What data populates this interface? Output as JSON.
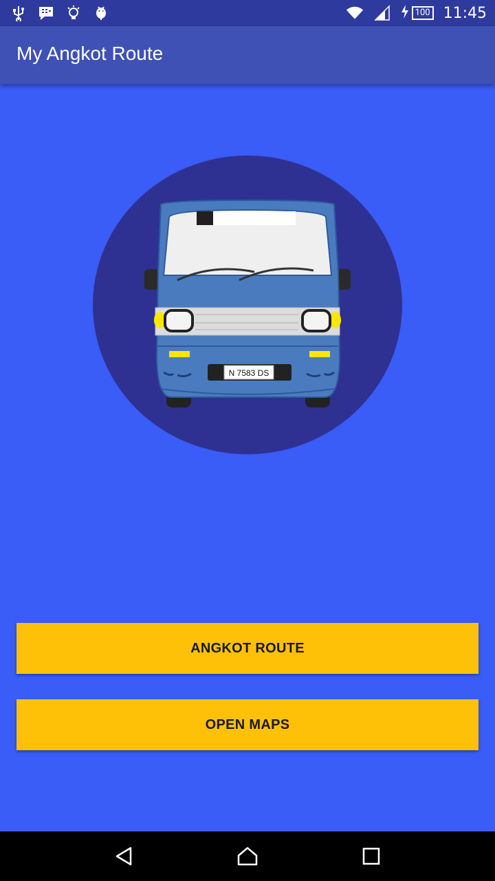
{
  "status_bar": {
    "time": "11:45",
    "battery": "100",
    "left_icons": [
      "usb-icon",
      "bbm-icon",
      "lightbulb-icon",
      "android-debug-icon"
    ],
    "right_icons": [
      "wifi-icon",
      "signal-icon",
      "charging-icon",
      "battery-icon"
    ]
  },
  "app_bar": {
    "title": "My Angkot Route"
  },
  "hero": {
    "plate": "N 7583 DS"
  },
  "buttons": {
    "angkot_route": "ANGKOT ROUTE",
    "open_maps": "OPEN MAPS"
  },
  "colors": {
    "background": "#3a5cf7",
    "app_bar": "#3f51b5",
    "status_bar": "#2e3a9e",
    "circle": "#2e3192",
    "button": "#ffc107",
    "van": "#4a7bbf"
  },
  "nav_bar": {
    "icons": [
      "back-icon",
      "home-icon",
      "recents-icon"
    ]
  }
}
